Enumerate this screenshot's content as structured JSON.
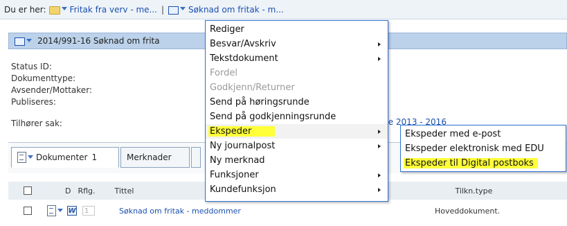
{
  "breadcrumb": {
    "label": "Du er her:",
    "crumbs": [
      "Fritak fra verv - me...",
      "Søknad om fritak - m..."
    ],
    "separator": "|"
  },
  "panel": {
    "title": "2014/991-16   Søknad om frita"
  },
  "fields": {
    "status": "Status ID:",
    "doctype": "Dokumenttype:",
    "sender": "Avsender/Mottaker:",
    "published": "Publiseres:",
    "belongs": "Tilhører sak:",
    "belongs_value_fragment": "mare 2013 - 2016"
  },
  "tabs": [
    {
      "label": "Dokumenter",
      "count": "1"
    },
    {
      "label": "Merknader"
    }
  ],
  "table": {
    "headers": {
      "d": "D",
      "rflg": "Rflg.",
      "title": "Tittel",
      "type": "Tilkn.type"
    },
    "rows": [
      {
        "num": "1",
        "title": "Søknad om fritak - meddommer",
        "type": "Hoveddokument."
      }
    ]
  },
  "context_menu": {
    "items": [
      {
        "label": "Rediger"
      },
      {
        "label": "Besvar/Avskriv",
        "submenu": true
      },
      {
        "label": "Tekstdokument",
        "submenu": true
      },
      {
        "label": "Fordel",
        "disabled": true
      },
      {
        "label": "Godkjenn/Returner",
        "disabled": true
      },
      {
        "label": "Send på høringsrunde"
      },
      {
        "label": "Send på godkjenningsrunde"
      },
      {
        "label": "Ekspeder",
        "submenu": true,
        "highlighted": true
      },
      {
        "label": "Ny journalpost",
        "submenu": true
      },
      {
        "label": "Ny merknad"
      },
      {
        "label": "Funksjoner",
        "submenu": true
      },
      {
        "label": "Kundefunksjon",
        "submenu": true
      }
    ]
  },
  "submenu": {
    "items": [
      {
        "label": "Ekspeder med e-post"
      },
      {
        "label": "Ekspeder elektronisk med EDU"
      },
      {
        "label": "Ekspeder til Digital postboks",
        "highlighted": true
      }
    ]
  },
  "colors": {
    "highlight": "#ffff3a",
    "link": "#1a4fb0",
    "menu_border": "#2f6fd1",
    "panel_header": "#bcd2ea"
  }
}
